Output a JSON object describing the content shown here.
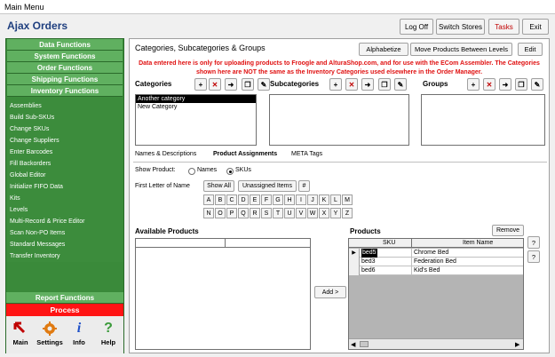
{
  "window": {
    "title": "Main Menu"
  },
  "app": {
    "title": "Ajax Orders"
  },
  "top_buttons": {
    "logoff": "Log Off",
    "switch_stores": "Switch Stores",
    "tasks": "Tasks",
    "exit": "Exit"
  },
  "sidebar": {
    "sections": [
      "Data Functions",
      "System Functions",
      "Order Functions",
      "Shipping Functions",
      "Inventory Functions"
    ],
    "items": [
      "Assemblies",
      "Build Sub-SKUs",
      "Change SKUs",
      "Change Suppliers",
      "Enter Barcodes",
      "Fill Backorders",
      "Global Editor",
      "Initialize FIFO Data",
      "Kits",
      "Levels",
      "Multi-Record & Price Editor",
      "Scan Non-PO Items",
      "Standard Messages",
      "Transfer Inventory"
    ],
    "report": "Report Functions",
    "process": "Process",
    "icons": [
      {
        "label": "Main"
      },
      {
        "label": "Settings"
      },
      {
        "label": "Info"
      },
      {
        "label": "Help"
      }
    ]
  },
  "panel": {
    "title": "Categories, Subcategories & Groups",
    "alphabetize": "Alphabetize",
    "move_products": "Move Products Between Levels",
    "edit": "Edit",
    "notice": "Data entered here is only for uploading products to Froogle and AlturaShop.com, and for use with the ECom Assembler. The Categories shown here are NOT the same as the Inventory Categories used elsewhere in the Order Manager.",
    "categories_label": "Categories",
    "subcategories_label": "Subcategories",
    "groups_label": "Groups",
    "categories": [
      "Another category",
      "New Category"
    ],
    "tabs": [
      "Names & Descriptions",
      "Product Assignments",
      "META Tags"
    ],
    "show_product_label": "Show Product:",
    "radio_names": "Names",
    "radio_skus": "SKUs",
    "first_letter_label": "First Letter of Name",
    "show_all": "Show All",
    "unassigned": "Unassigned Items",
    "hash": "#",
    "letters_row1": [
      "A",
      "B",
      "C",
      "D",
      "E",
      "F",
      "G",
      "H",
      "I",
      "J",
      "K",
      "L",
      "M"
    ],
    "letters_row2": [
      "N",
      "O",
      "P",
      "Q",
      "R",
      "S",
      "T",
      "U",
      "V",
      "W",
      "X",
      "Y",
      "Z"
    ],
    "available_label": "Available Products",
    "products_label": "Products",
    "remove": "Remove",
    "add": "Add >",
    "question": "?",
    "grid": {
      "columns": [
        "SKU",
        "Item Name"
      ],
      "rows": [
        [
          "bed5",
          "Chrome Bed"
        ],
        [
          "bed3",
          "Federation Bed"
        ],
        [
          "bed6",
          "Kid's Bed"
        ]
      ]
    }
  }
}
